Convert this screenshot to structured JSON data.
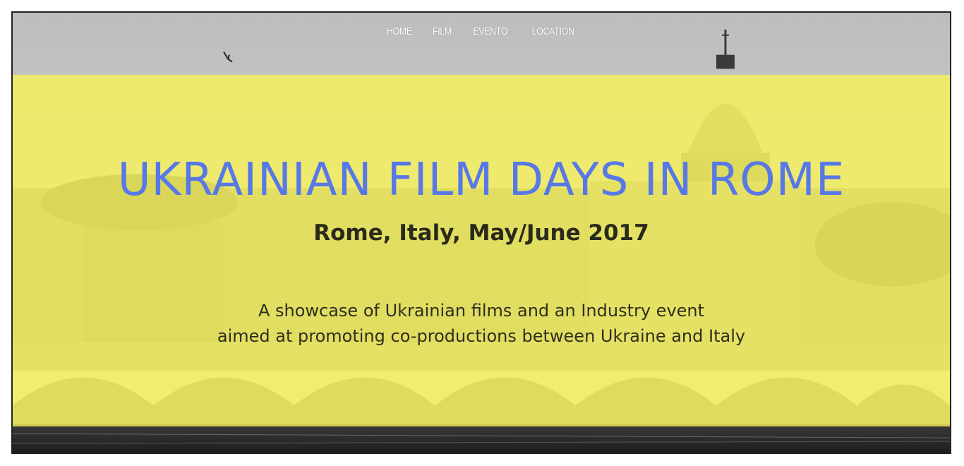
{
  "nav": {
    "items": [
      {
        "label": "HOME"
      },
      {
        "label": "FILM"
      },
      {
        "label": "EVENTO"
      },
      {
        "label": "LOCATION"
      }
    ]
  },
  "hero": {
    "title": "UKRAINIAN FILM DAYS IN ROME",
    "subtitle": "Rome, Italy, May/June 2017",
    "tagline_line1": "A showcase of Ukrainian films and an Industry event",
    "tagline_line2": "aimed at promoting co-productions between Ukraine and Italy"
  },
  "colors": {
    "overlay": "#f6f258",
    "title": "#5878e8",
    "text": "#2a2a1a",
    "nav_text": "#ffffff"
  }
}
